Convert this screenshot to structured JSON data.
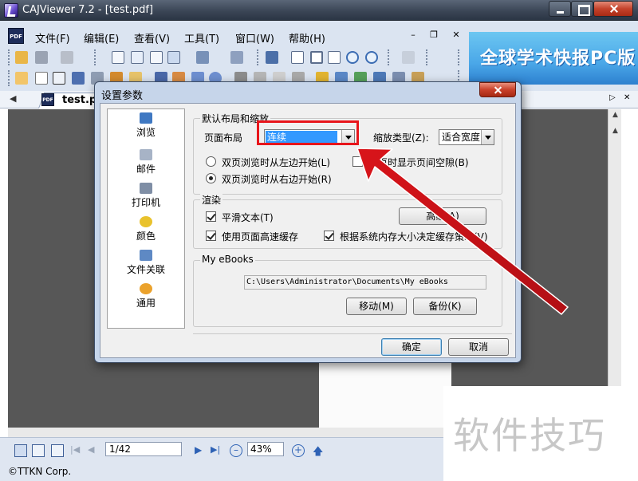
{
  "window": {
    "title": "CAJViewer 7.2 - [test.pdf]"
  },
  "menubar": {
    "items": [
      "文件(F)",
      "编辑(E)",
      "查看(V)",
      "工具(T)",
      "窗口(W)",
      "帮助(H)"
    ],
    "mdi_minimize": "–",
    "mdi_restore": "❐",
    "mdi_close": "✕"
  },
  "banner": {
    "text": "全球学术快报PC版"
  },
  "tab": {
    "label": "test.pdf"
  },
  "statusbar": {
    "page": "1/42",
    "zoom": "43%",
    "copyright": "©TTKN Corp."
  },
  "watermark": {
    "text": "软件技巧"
  },
  "dialog": {
    "title": "设置参数",
    "nav": [
      {
        "label": "浏览",
        "icon": "browse-icon"
      },
      {
        "label": "邮件",
        "icon": "mail-icon"
      },
      {
        "label": "打印机",
        "icon": "printer-icon"
      },
      {
        "label": "颜色",
        "icon": "color-icon"
      },
      {
        "label": "文件关联",
        "icon": "file-association-icon"
      },
      {
        "label": "通用",
        "icon": "general-icon"
      }
    ],
    "layout_group": {
      "title": "默认布局和缩放",
      "page_layout_label": "页面布局",
      "page_layout_value": "连续",
      "zoom_type_label": "缩放类型(Z):",
      "zoom_type_value": "适合宽度",
      "radio_left": "双页浏览时从左边开始(L)",
      "radio_right": "双页浏览时从右边开始(R)",
      "show_gap": "双页时显示页间空隙(B)",
      "radio_selected": "right"
    },
    "render_group": {
      "title": "渲染",
      "smooth_text": "平滑文本(T)",
      "use_cache": "使用页面高速缓存",
      "system_memory": "根据系统内存大小决定缓存策略(V)",
      "advanced_button": "高级(A)"
    },
    "ebooks_group": {
      "title": "My eBooks",
      "path": "C:\\Users\\Administrator\\Documents\\My eBooks",
      "move_button": "移动(M)",
      "backup_button": "备份(K)"
    },
    "ok_button": "确定",
    "cancel_button": "取消"
  },
  "annotation": {
    "color": "#e8151b"
  }
}
